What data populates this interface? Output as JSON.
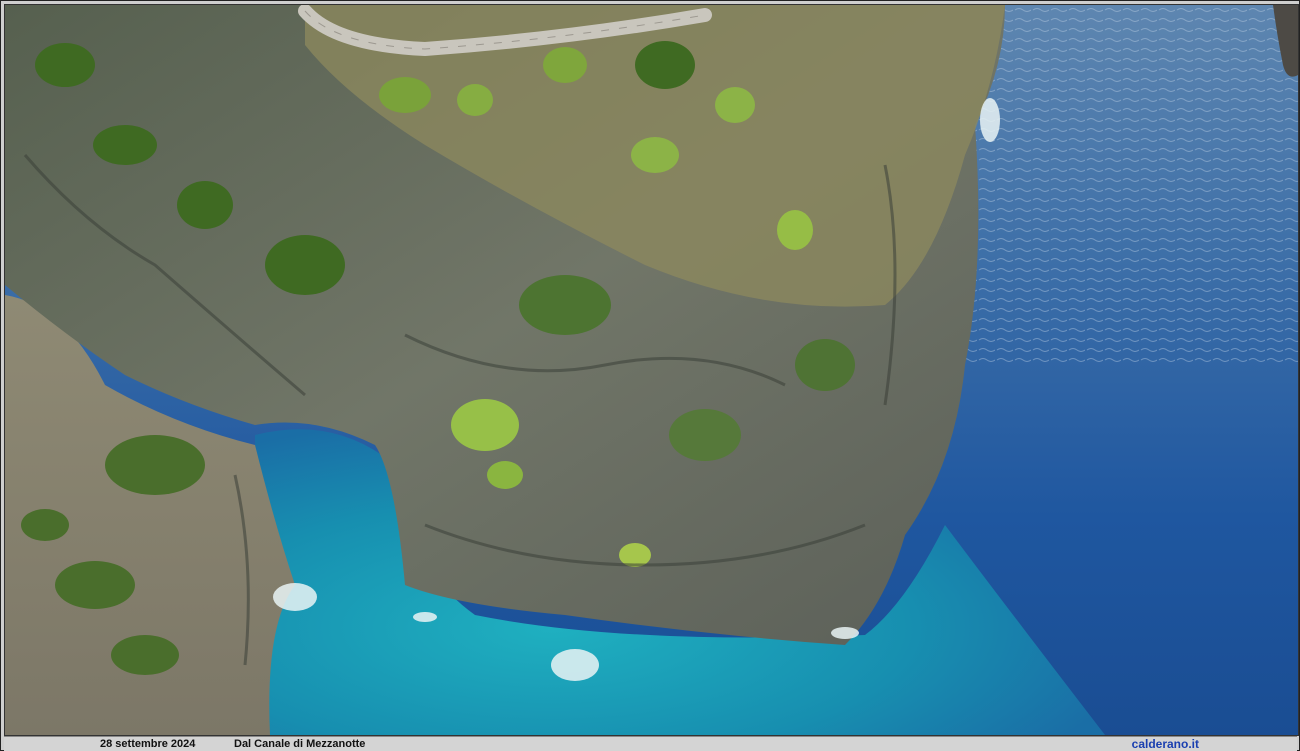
{
  "photo": {
    "subject": "aerial-coastal-cliff-photo"
  },
  "caption": {
    "date": "28 settembre 2024",
    "place": "Dal Canale di Mezzanotte",
    "site": "calderano.it"
  },
  "colors": {
    "sea_deep": "#1c4f93",
    "sea_shallow": "#1a9bb2",
    "cliff": "#6f7468",
    "vegetation": "#3f6a22",
    "site_link": "#1a3fb0"
  }
}
